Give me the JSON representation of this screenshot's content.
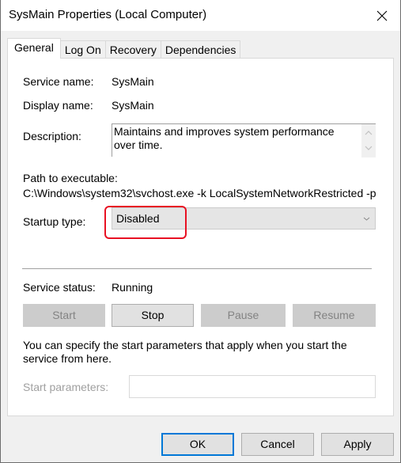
{
  "window": {
    "title": "SysMain Properties (Local Computer)"
  },
  "tabs": [
    {
      "label": "General",
      "active": true
    },
    {
      "label": "Log On",
      "active": false
    },
    {
      "label": "Recovery",
      "active": false
    },
    {
      "label": "Dependencies",
      "active": false
    }
  ],
  "general": {
    "service_name_label": "Service name:",
    "service_name": "SysMain",
    "display_name_label": "Display name:",
    "display_name": "SysMain",
    "description_label": "Description:",
    "description": "Maintains and improves system performance over time.",
    "path_label": "Path to executable:",
    "path": "C:\\Windows\\system32\\svchost.exe -k LocalSystemNetworkRestricted -p",
    "startup_type_label": "Startup type:",
    "startup_type": "Disabled",
    "service_status_label": "Service status:",
    "service_status": "Running",
    "buttons": {
      "start": "Start",
      "stop": "Stop",
      "pause": "Pause",
      "resume": "Resume"
    },
    "info_text": "You can specify the start parameters that apply when you start the service from here.",
    "start_parameters_label": "Start parameters:",
    "start_parameters_value": ""
  },
  "footer": {
    "ok": "OK",
    "cancel": "Cancel",
    "apply": "Apply"
  },
  "colors": {
    "highlight": "#e81123",
    "default_button_border": "#0078d7"
  }
}
